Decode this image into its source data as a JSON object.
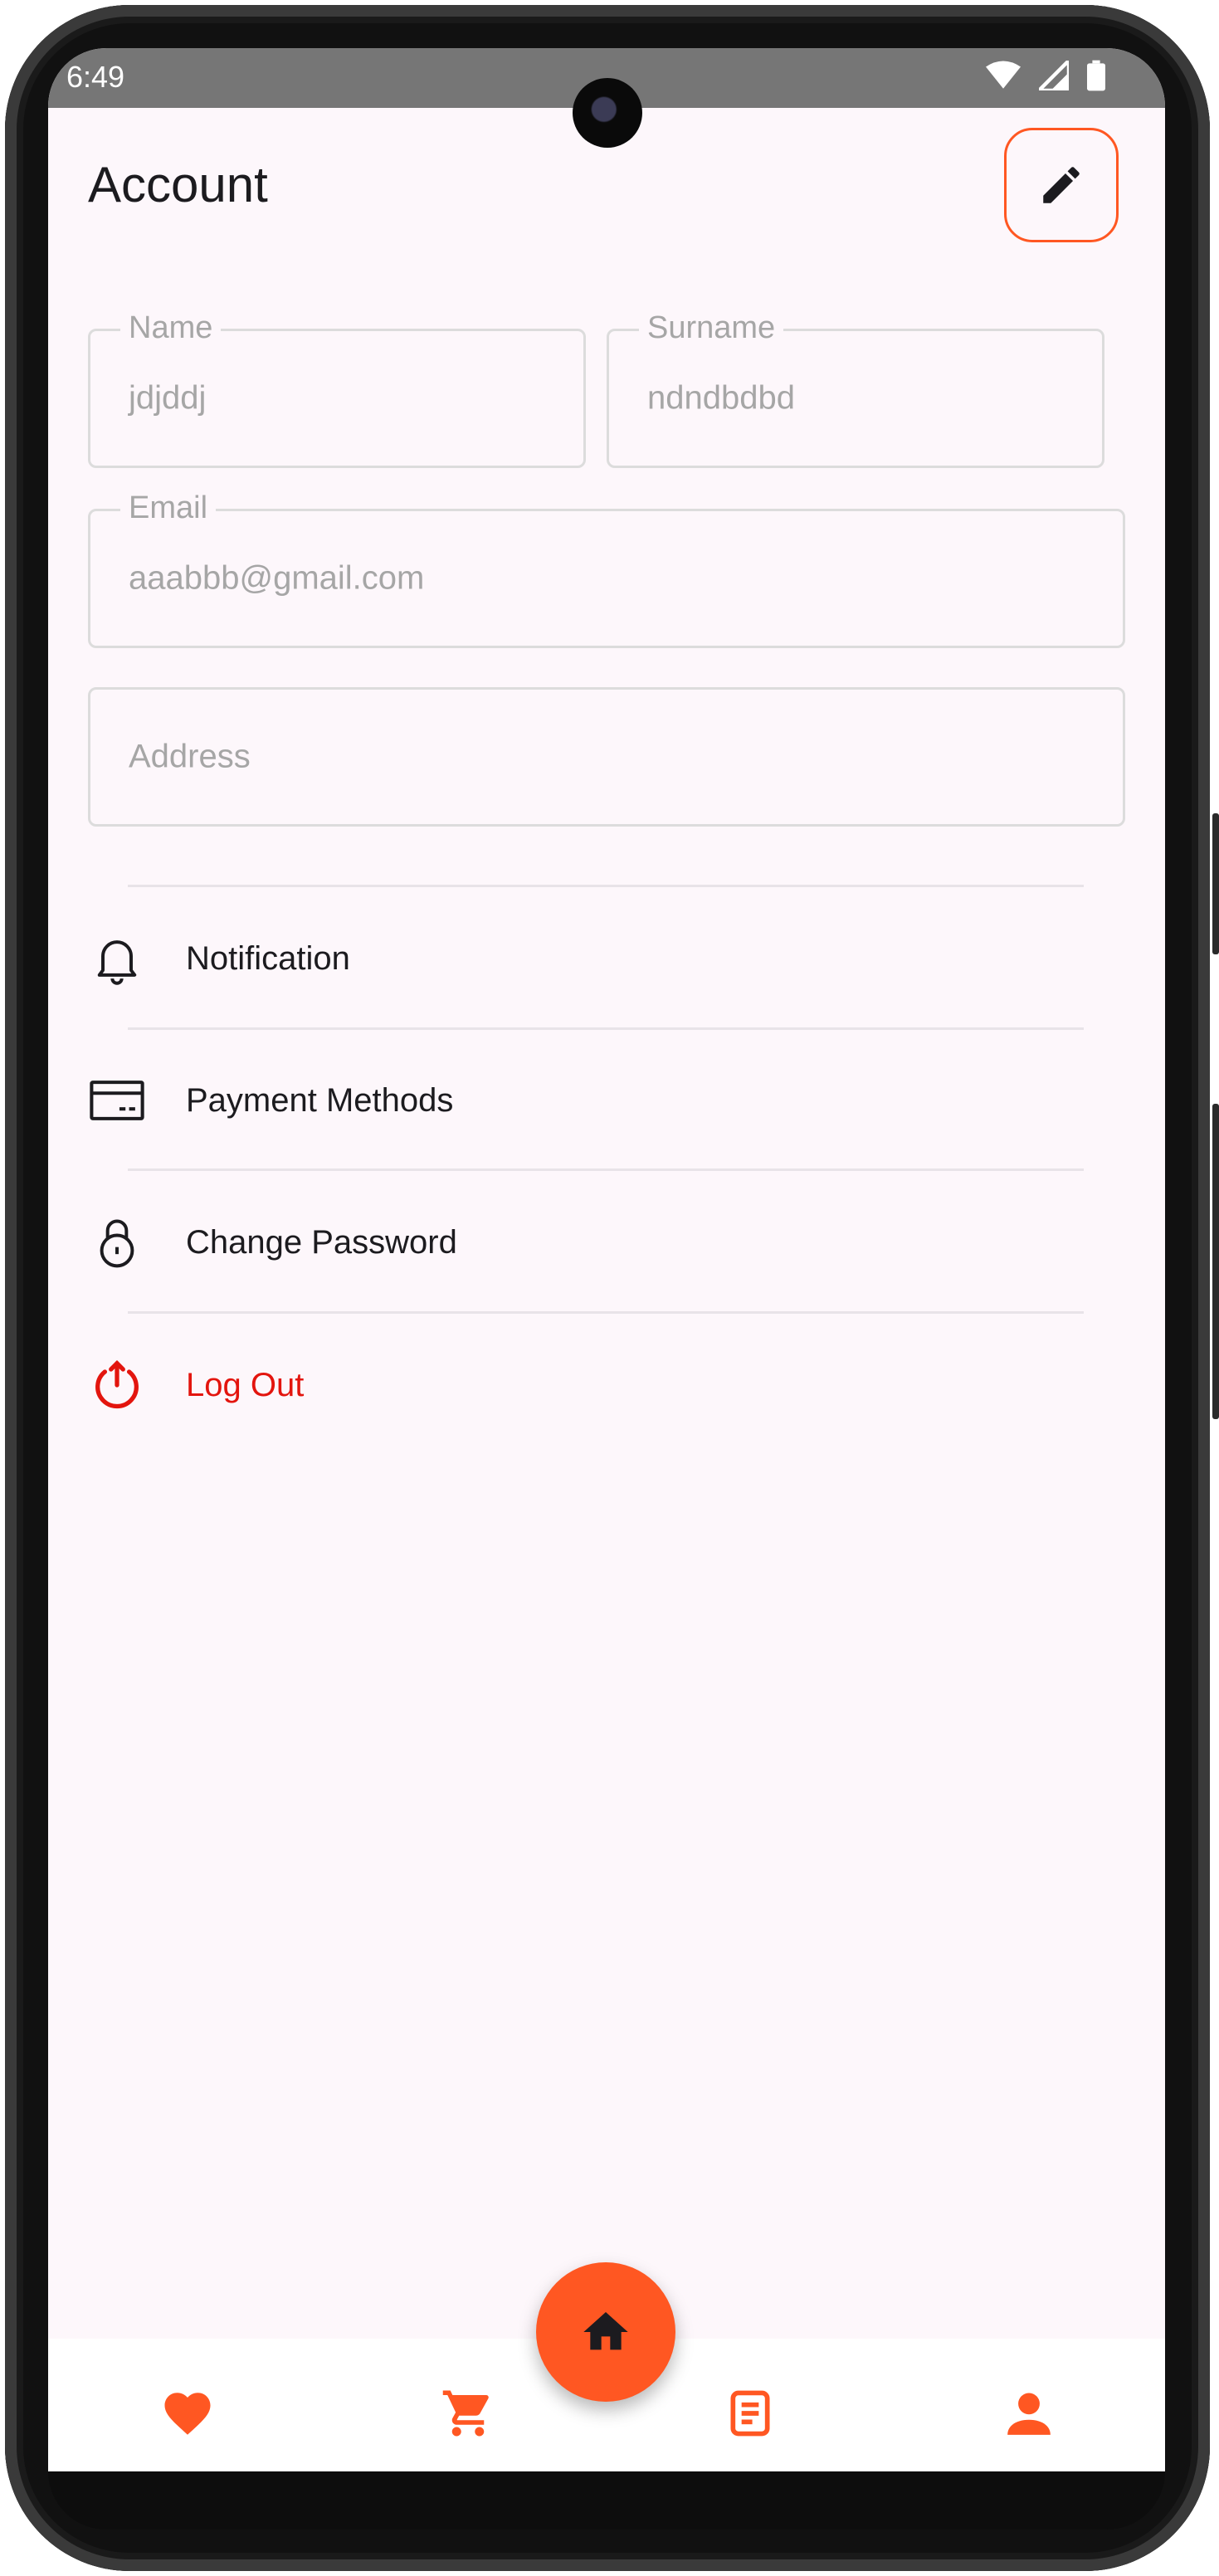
{
  "status_bar": {
    "time": "6:49"
  },
  "header": {
    "title": "Account",
    "edit_icon": "pencil-icon"
  },
  "form": {
    "name": {
      "label": "Name",
      "value": "jdjddj"
    },
    "surname": {
      "label": "Surname",
      "value": "ndndbdbd"
    },
    "email": {
      "label": "Email",
      "value": "aaabbb@gmail.com"
    },
    "address": {
      "placeholder": "Address"
    }
  },
  "menu": {
    "notification": {
      "label": "Notification",
      "icon": "bell-icon"
    },
    "payment": {
      "label": "Payment Methods",
      "icon": "credit-card-icon"
    },
    "password": {
      "label": "Change Password",
      "icon": "lock-icon"
    },
    "logout": {
      "label": "Log Out",
      "icon": "power-icon"
    }
  },
  "bottom_nav": {
    "items": [
      {
        "icon": "heart-icon"
      },
      {
        "icon": "cart-icon"
      },
      {
        "icon": "home-icon"
      },
      {
        "icon": "document-icon"
      },
      {
        "icon": "person-icon"
      }
    ]
  },
  "colors": {
    "accent": "#ff5722",
    "logout": "#e3150e",
    "background": "#fdf7fb",
    "field_border": "#dcdcdc",
    "muted_text": "#a6a6a6"
  }
}
